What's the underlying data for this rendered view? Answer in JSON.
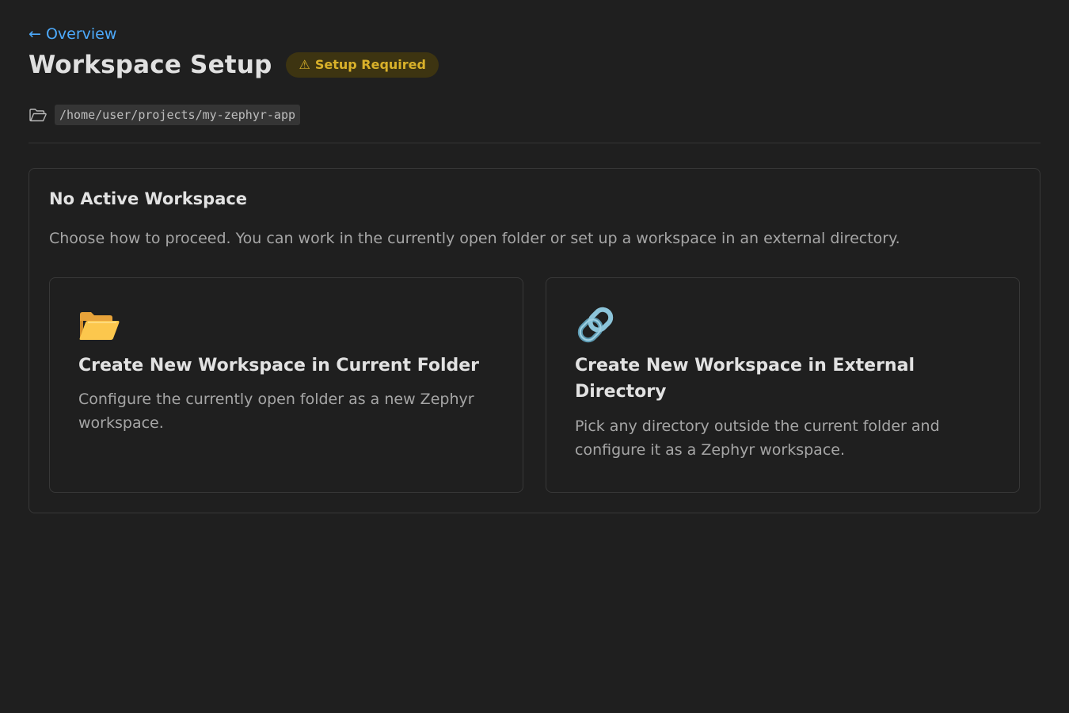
{
  "nav": {
    "back_label": "← Overview"
  },
  "header": {
    "title": "Workspace Setup",
    "badge_icon": "⚠",
    "badge_label": "Setup Required",
    "badge_color": "#d9b12a"
  },
  "path": {
    "icon": "folder-outline-icon",
    "value": "/home/user/projects/my-zephyr-app"
  },
  "panel": {
    "title": "No Active Workspace",
    "description": "Choose how to proceed. You can work in the currently open folder or set up a workspace in an external directory.",
    "options": [
      {
        "icon": "open-folder-icon",
        "title": "Create New Workspace in Current Folder",
        "description": "Configure the currently open folder as a new Zephyr workspace."
      },
      {
        "icon": "link-icon",
        "title": "Create New Workspace in External Directory",
        "description": "Pick any directory outside the current folder and configure it as a Zephyr workspace."
      }
    ]
  },
  "colors": {
    "background": "#1f1f1f",
    "accent_link": "#4daafc",
    "badge_background": "#3d3411",
    "border": "#383838"
  }
}
